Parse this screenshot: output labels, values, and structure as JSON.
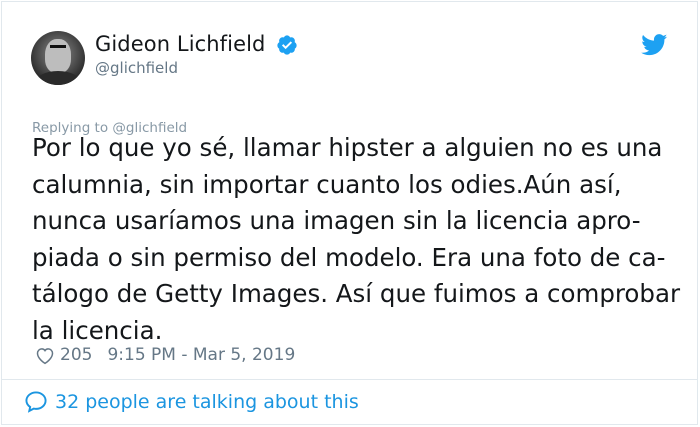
{
  "tweet": {
    "author_name": "Gideon Lichfield",
    "author_handle": "@glichfield",
    "replying_to": "Replying to @glichfield",
    "text": "Por lo que yo sé, llamar hipster a alguien no es una\ncalumnia, sin importar cuanto los odies.Aún así,\nnunca usaríamos una imagen sin la licencia apro-\npiada o sin permiso del modelo. Era una foto de ca-\ntálogo de Getty Images. Así que fuimos a comprobar\nla licencia.",
    "likes": "205",
    "timestamp": "9:15 PM - Mar 5, 2019",
    "conversation": "32 people are talking about this"
  },
  "icons": {
    "verified": "verified-badge-icon",
    "platform": "twitter-bird-icon",
    "like": "heart-icon",
    "reply": "speech-bubble-icon"
  },
  "colors": {
    "accent": "#1da1f2",
    "link": "#1b95e0",
    "text": "#14171a",
    "secondary": "#657786"
  }
}
